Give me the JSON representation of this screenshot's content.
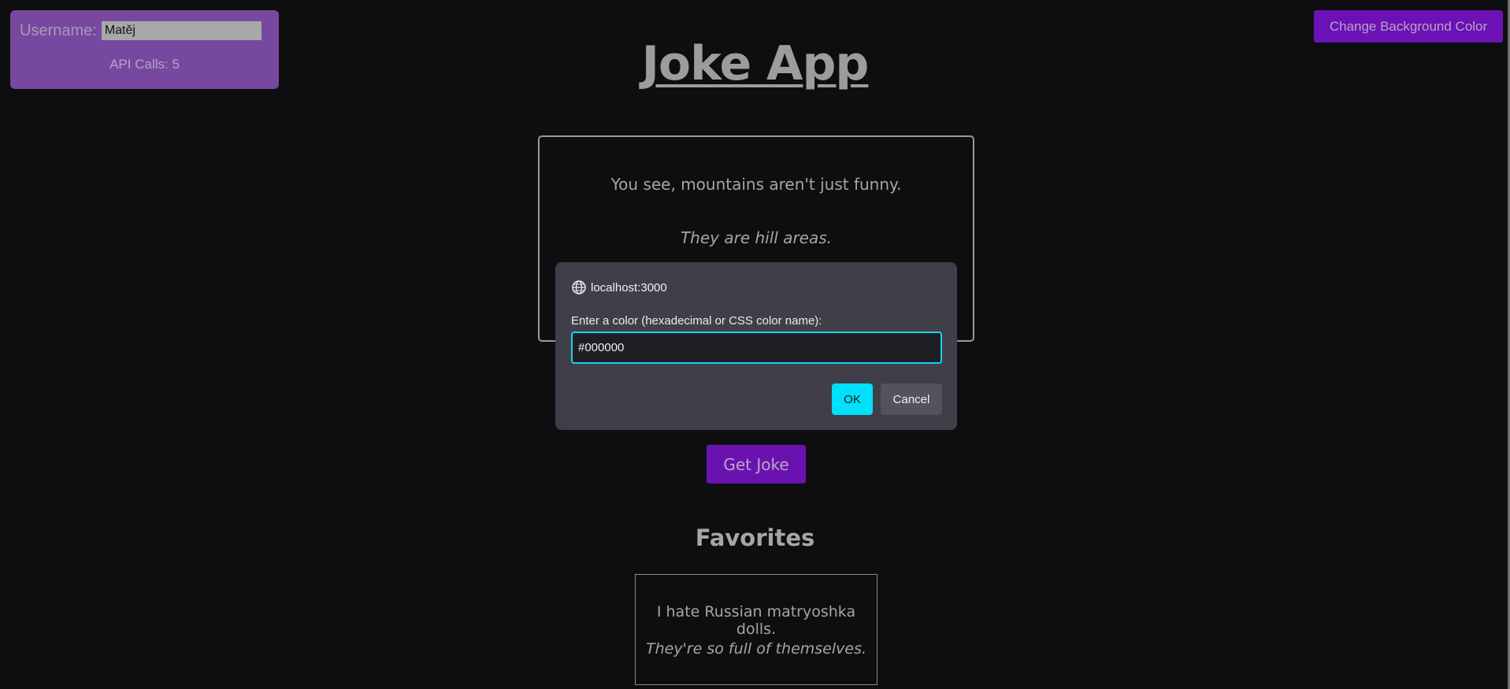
{
  "user_panel": {
    "username_label": "Username:",
    "username_value": "Matěj",
    "api_calls": "API Calls: 5"
  },
  "header": {
    "title": "Joke App",
    "change_bg_label": "Change Background Color"
  },
  "joke": {
    "setup": "You see, mountains aren't just funny.",
    "punchline": "They are hill areas."
  },
  "actions": {
    "get_joke_label": "Get Joke"
  },
  "favorites": {
    "heading": "Favorites",
    "items": [
      {
        "setup": "I hate Russian matryoshka dolls.",
        "punchline": "They're so full of themselves."
      }
    ]
  },
  "dialog": {
    "origin": "localhost:3000",
    "message": "Enter a color (hexadecimal or CSS color name):",
    "input_value": "#000000",
    "ok_label": "OK",
    "cancel_label": "Cancel",
    "icon": "globe-icon"
  },
  "colors": {
    "background": "#0e0e11",
    "user_panel": "#7748a0",
    "button_purple": "#6c11b5",
    "dialog_bg": "#403e48",
    "dialog_accent": "#00e0fb"
  }
}
